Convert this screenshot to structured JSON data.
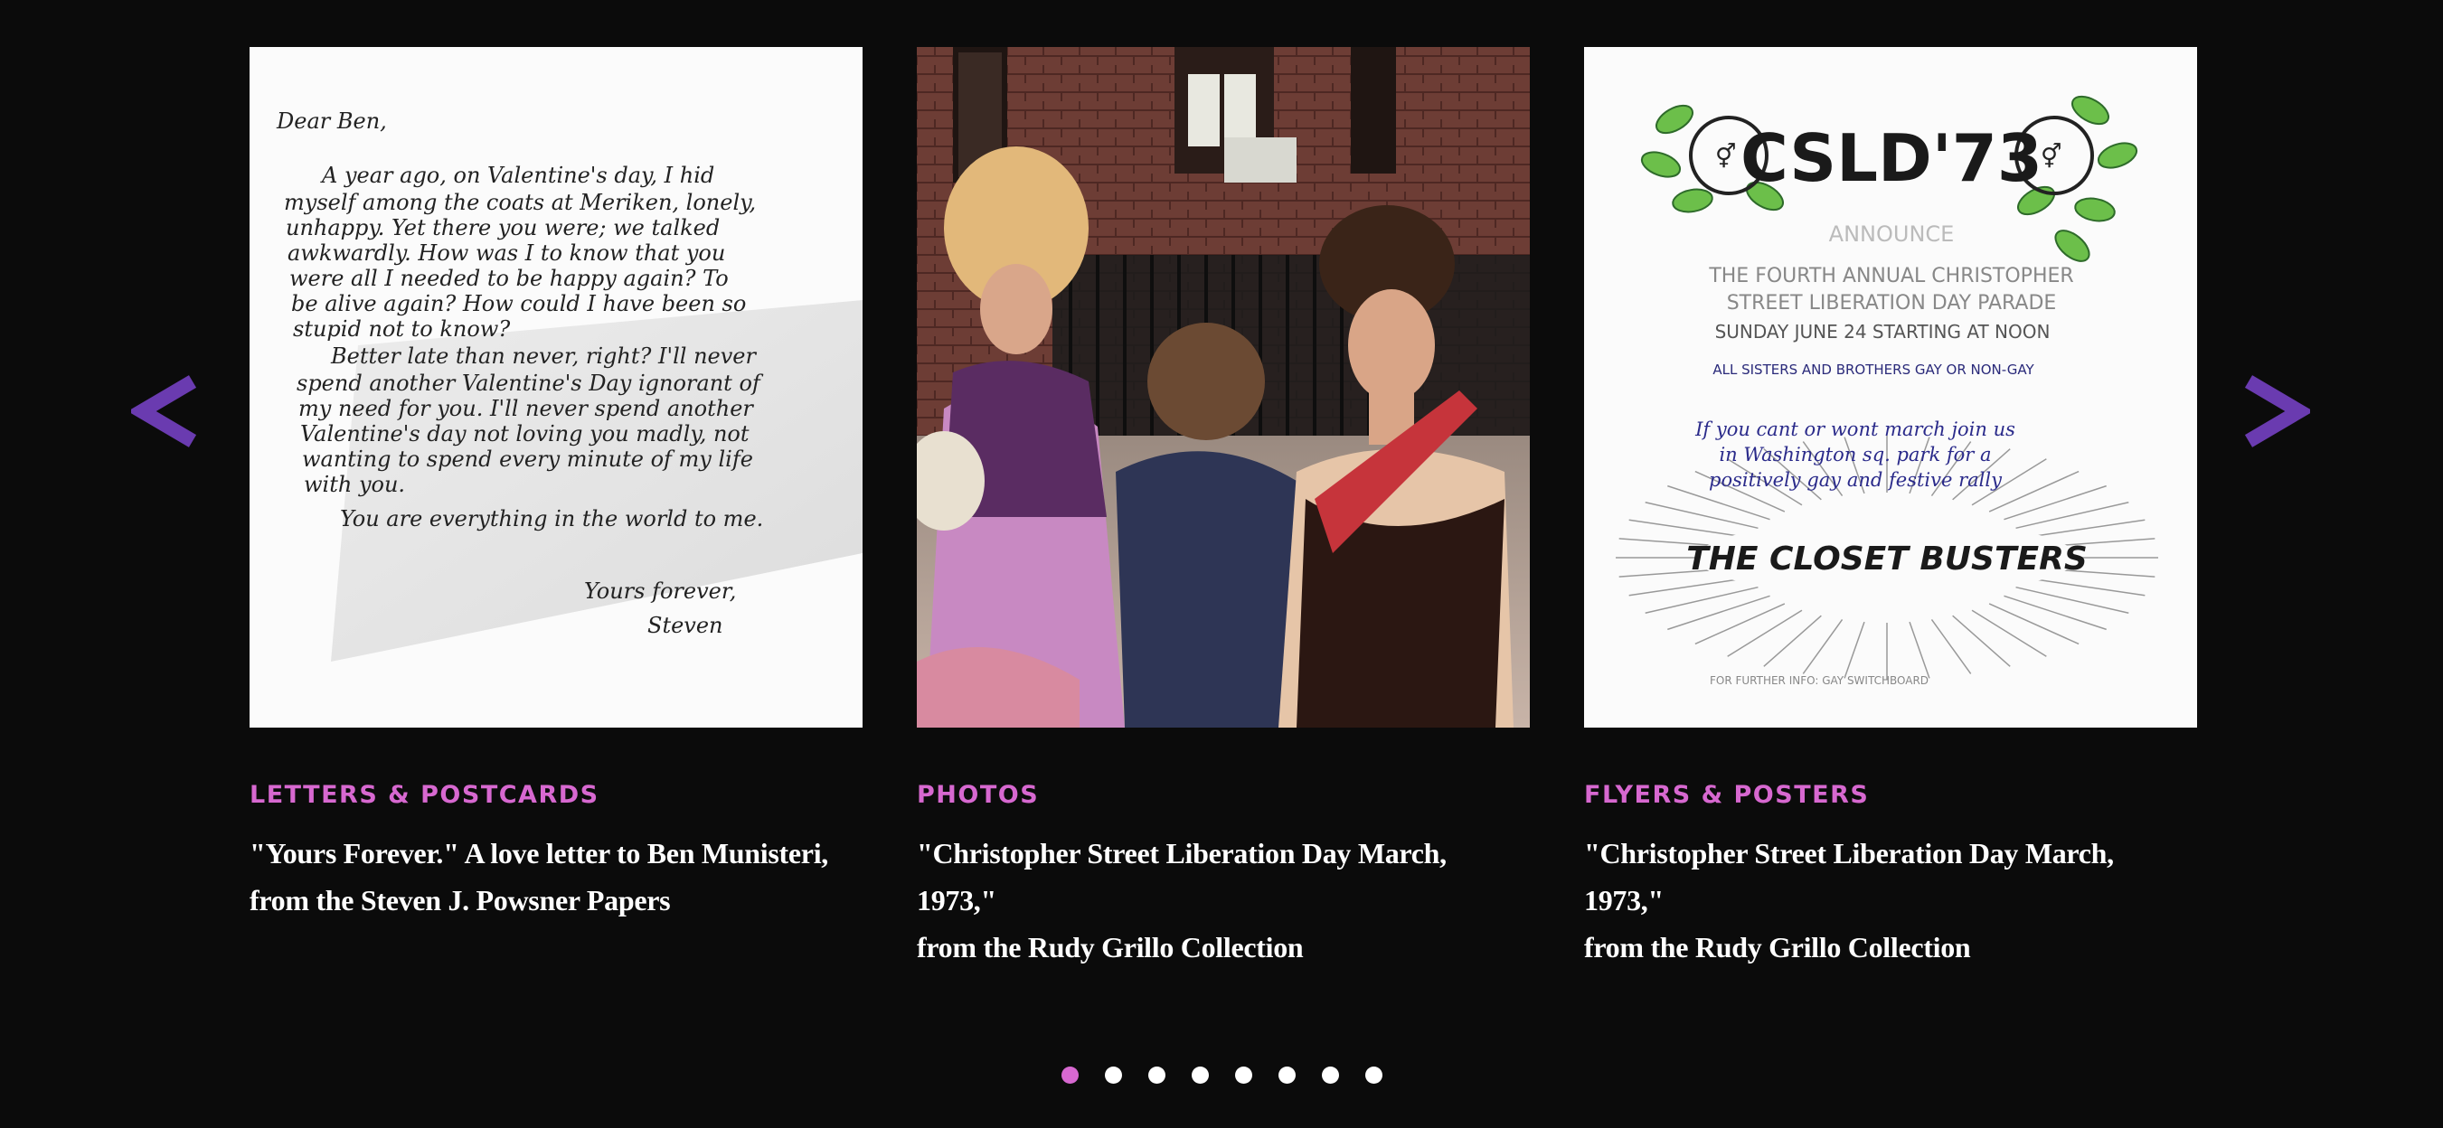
{
  "carousel": {
    "prev_icon": "chevron-left-icon",
    "next_icon": "chevron-right-icon",
    "accent_color": "#d768d0",
    "arrow_color": "#6a3bb0",
    "cards": [
      {
        "category": "LETTERS & POSTCARDS",
        "caption_line1": "\"Yours Forever.\" A love letter to Ben Munisteri,",
        "caption_line2": "from the Steven J. Powsner Papers",
        "image": "handwritten-letter",
        "letter_lines": [
          "Dear Ben,",
          "A year ago, on Valentine's day, I hid",
          "myself among the coats at Meriken, lonely,",
          "unhappy. Yet there you were; we talked",
          "awkwardly. How was I to know that you",
          "were all I needed to be happy again? To",
          "be alive again? How could I have been so",
          "stupid not to know?",
          "Better late than never, right? I'll never",
          "spend another Valentine's Day ignorant of",
          "my need for you. I'll never spend another",
          "Valentine's day not loving you madly, not",
          "wanting to spend every minute of my life",
          "with you.",
          "You are everything in the world to me.",
          "Yours forever,",
          "Steven"
        ]
      },
      {
        "category": "PHOTOS",
        "caption_line1": "\"Christopher Street Liberation Day March, 1973,\"",
        "caption_line2": "from the Rudy Grillo Collection",
        "image": "march-photo"
      },
      {
        "category": "FLYERS & POSTERS",
        "caption_line1": "\"Christopher Street Liberation Day March, 1973,\"",
        "caption_line2": "from the Rudy Grillo Collection",
        "image": "flyer",
        "flyer_title": "CSLD'73",
        "flyer_lines": [
          "ANNOUNCE",
          "THE FOURTH ANNUAL CHRISTOPHER",
          "STREET LIBERATION DAY PARADE",
          "SUNDAY JUNE 24 STARTING AT NOON",
          "ALL SISTERS AND BROTHERS GAY OR NON-GAY",
          "If you cant or wont march join us",
          "in Washington sq. park for a",
          "positively gay and festive rally",
          "THE CLOSET BUSTERS",
          "FOR FURTHER INFO: GAY SWITCHBOARD"
        ]
      }
    ],
    "dots_total": 8,
    "active_dot": 1
  }
}
